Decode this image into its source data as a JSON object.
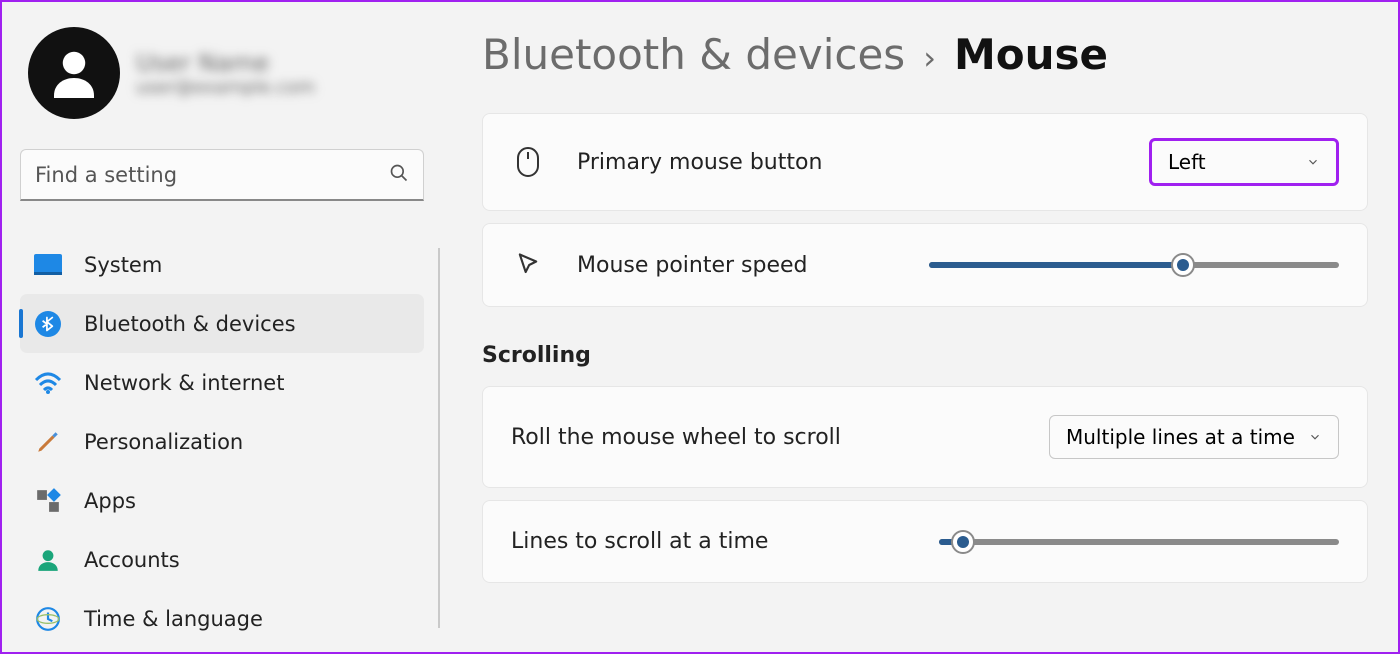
{
  "profile": {
    "name": "User Name",
    "email": "user@example.com"
  },
  "search": {
    "placeholder": "Find a setting"
  },
  "sidebar": {
    "items": [
      {
        "label": "System",
        "icon": "system"
      },
      {
        "label": "Bluetooth & devices",
        "icon": "bluetooth",
        "active": true
      },
      {
        "label": "Network & internet",
        "icon": "network"
      },
      {
        "label": "Personalization",
        "icon": "personalization"
      },
      {
        "label": "Apps",
        "icon": "apps"
      },
      {
        "label": "Accounts",
        "icon": "accounts"
      },
      {
        "label": "Time & language",
        "icon": "time"
      }
    ]
  },
  "breadcrumb": {
    "parent": "Bluetooth & devices",
    "current": "Mouse"
  },
  "settings": {
    "primary_button": {
      "label": "Primary mouse button",
      "value": "Left"
    },
    "pointer_speed": {
      "label": "Mouse pointer speed",
      "value_pct": 62
    },
    "section_scrolling": "Scrolling",
    "wheel_scroll": {
      "label": "Roll the mouse wheel to scroll",
      "value": "Multiple lines at a time"
    },
    "lines_scroll": {
      "label": "Lines to scroll at a time",
      "value_pct": 6
    }
  }
}
